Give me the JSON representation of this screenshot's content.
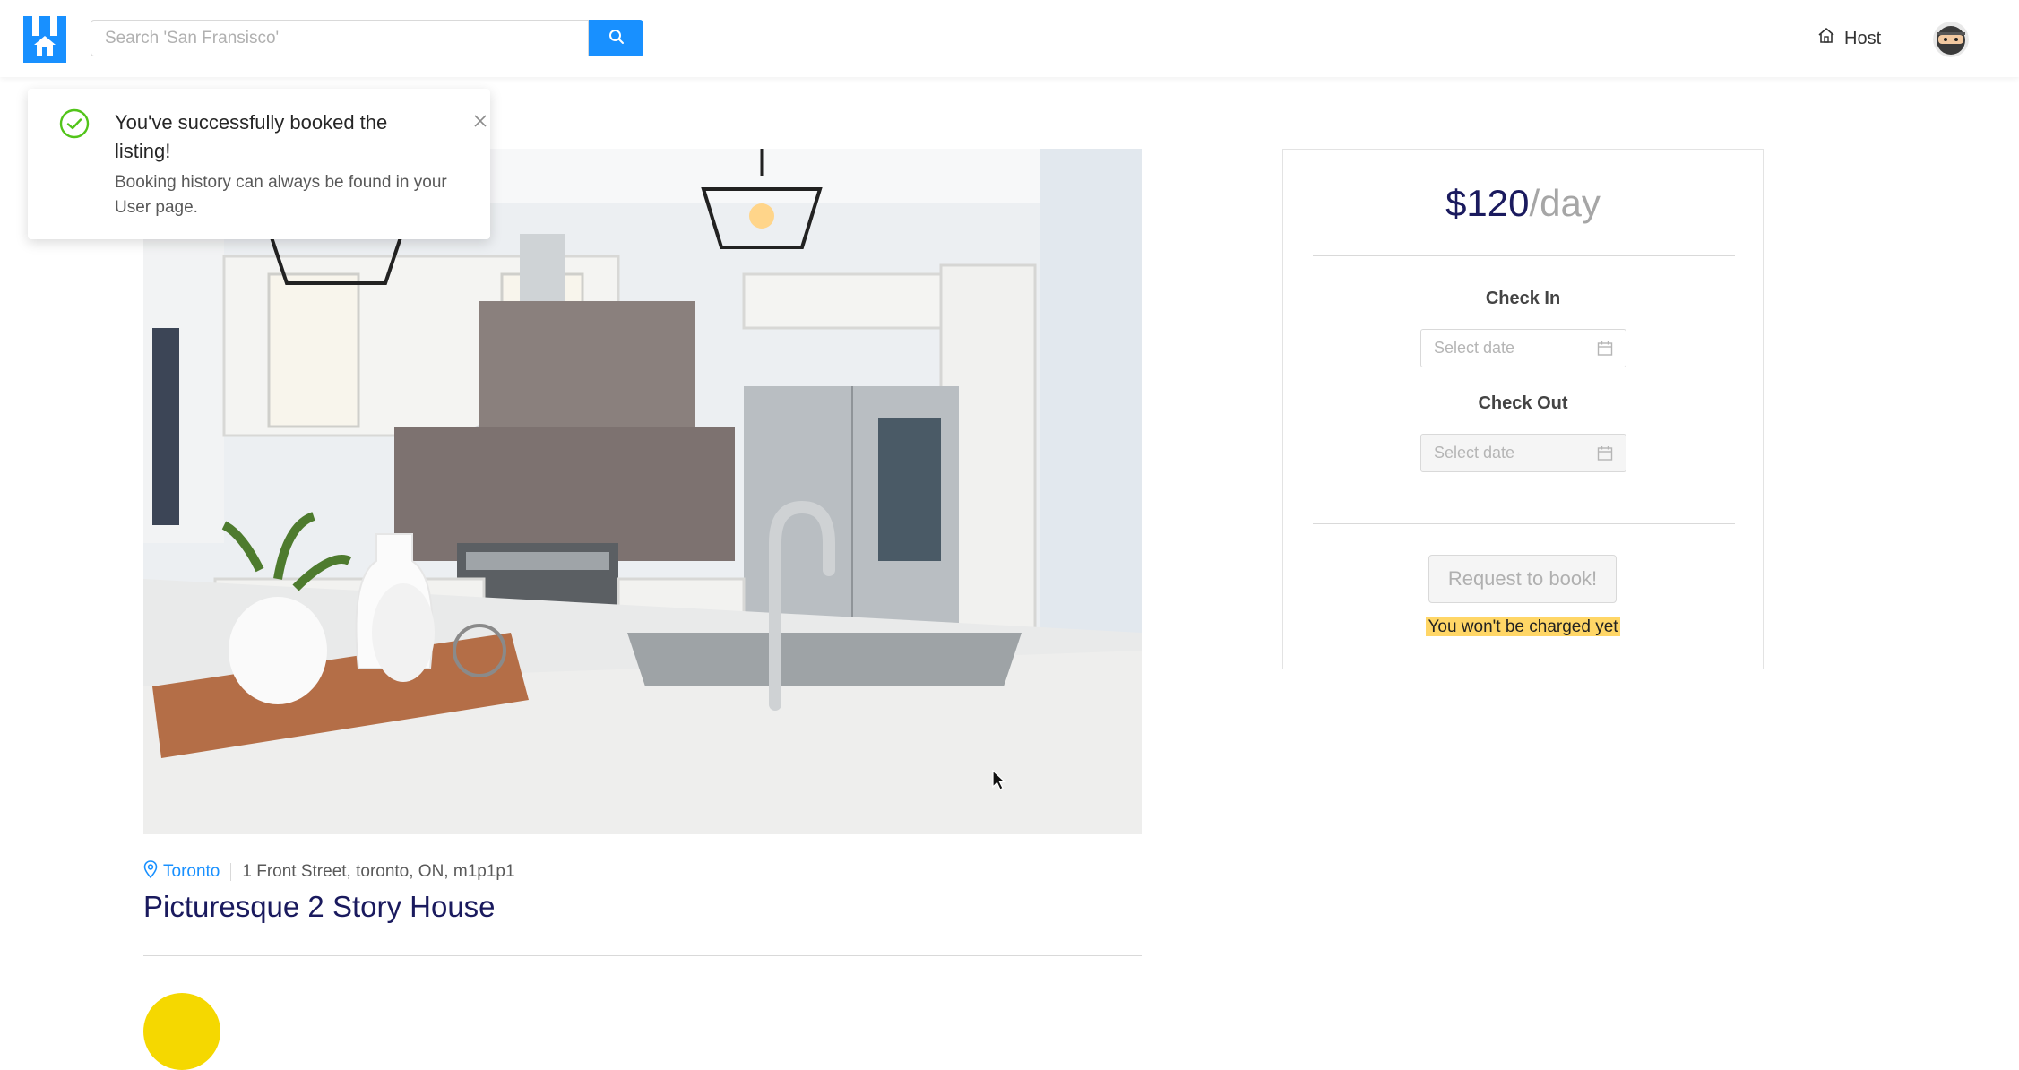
{
  "header": {
    "search": {
      "placeholder": "Search 'San Fransisco'",
      "value": ""
    },
    "host_label": "Host",
    "icons": {
      "logo": "house-logo-icon",
      "search": "search-icon",
      "host": "home-icon",
      "avatar": "ninja-avatar"
    }
  },
  "notification": {
    "title": "You've successfully booked the listing!",
    "description": "Booking history can always be found in your User page.",
    "icons": {
      "status": "check-circle-icon",
      "close": "close-icon"
    }
  },
  "listing": {
    "city": "Toronto",
    "address": "1 Front Street, toronto, ON, m1p1p1",
    "title": "Picturesque 2 Story House"
  },
  "booking": {
    "price": "$120",
    "price_unit": "/day",
    "check_in_label": "Check In",
    "check_in_placeholder": "Select date",
    "check_out_label": "Check Out",
    "check_out_placeholder": "Select date",
    "book_button": "Request to book!",
    "charge_note": "You won't be charged yet"
  },
  "colors": {
    "accent": "#1890ff",
    "title": "#1a1a5e",
    "success": "#52c41a",
    "highlight": "#ffd666",
    "host_avatar": "#f5d800"
  }
}
